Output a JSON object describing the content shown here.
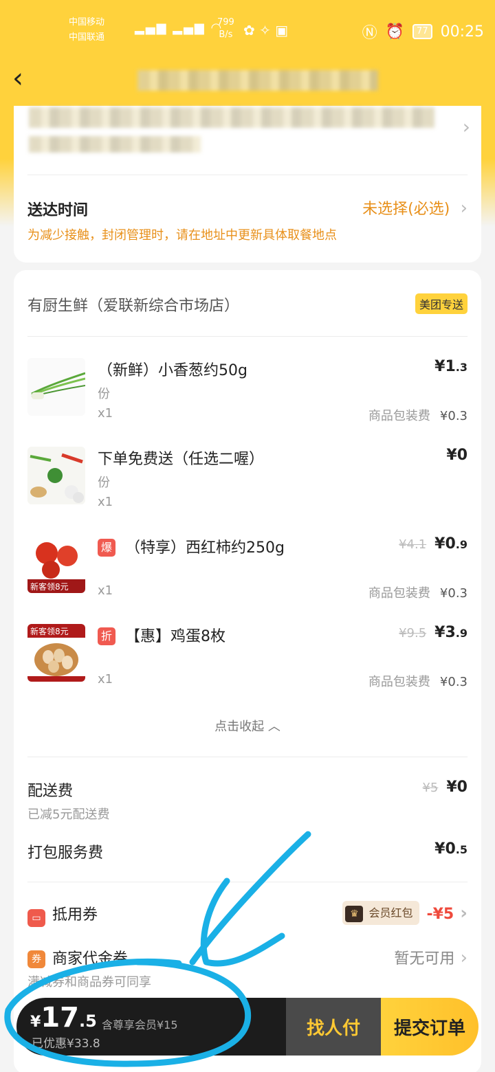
{
  "status_bar": {
    "carrier1": "中国移动",
    "carrier2": "中国联通",
    "speed_value": "799",
    "speed_unit": "B/s",
    "battery": "77",
    "time": "00:25"
  },
  "delivery": {
    "time_label": "送达时间",
    "time_value": "未选择(必选)",
    "notice": "为减少接触，封闭管理时，请在地址中更新具体取餐地点"
  },
  "shop": {
    "name": "有厨生鲜（爱联新综合市场店）",
    "badge": "美团专送"
  },
  "items": [
    {
      "name": "（新鲜）小香葱约50g",
      "unit": "份",
      "qty": "x1",
      "price_int": "1",
      "price_dec": ".3",
      "pack_label": "商品包装费",
      "pack_fee": "¥0.3"
    },
    {
      "name": "下单免费送（任选二喔）",
      "unit": "份",
      "qty": "x1",
      "price_int": "0",
      "price_dec": ""
    },
    {
      "tag": "爆",
      "name": "（特享）西红柿约250g",
      "qty": "x1",
      "old_price": "¥4.1",
      "price_int": "0",
      "price_dec": ".9",
      "pack_label": "商品包装费",
      "pack_fee": "¥0.3",
      "thumb_text": "新客领8元"
    },
    {
      "tag": "折",
      "name": "【惠】鸡蛋8枚",
      "qty": "x1",
      "old_price": "¥9.5",
      "price_int": "3",
      "price_dec": ".9",
      "pack_label": "商品包装费",
      "pack_fee": "¥0.3",
      "thumb_text": "新客领8元"
    }
  ],
  "collapse_label": "点击收起",
  "fees": {
    "delivery_label": "配送费",
    "delivery_old": "¥5",
    "delivery_value": "¥0",
    "delivery_sub": "已减5元配送费",
    "packing_label": "打包服务费",
    "packing_value_int": "¥0",
    "packing_value_dec": ".5"
  },
  "coupons": {
    "coupon_label": "抵用券",
    "vip_badge": "会员红包",
    "coupon_value": "-¥5",
    "merchant_label": "商家代金券",
    "merchant_icon": "券",
    "merchant_value": "暂无可用",
    "merchant_sub": "满减券和商品券可同享"
  },
  "bottom": {
    "yen": "¥",
    "total_int": "17",
    "total_dec": ".5",
    "vip_note": "含尊享会员¥15",
    "saved": "已优惠¥33.8",
    "pay_friend": "找人付",
    "submit": "提交订单"
  },
  "colors": {
    "brand_yellow": "#ffd23c",
    "accent_orange": "#e8901a",
    "discount_red": "#ef4a3c",
    "annotation_blue": "#1ab0e6"
  }
}
